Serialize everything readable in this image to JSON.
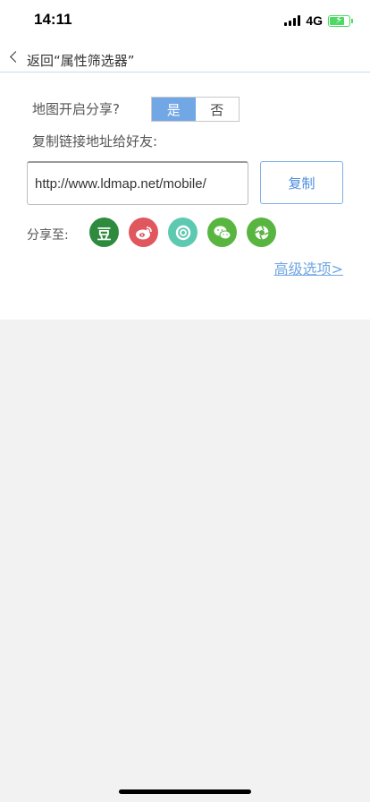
{
  "status_bar": {
    "time": "14:11",
    "network": "4G",
    "battery_color": "#4cd964"
  },
  "nav": {
    "back_icon": "chevron-left-icon",
    "title": "返回“属性筛选器”"
  },
  "share": {
    "question": "地图开启分享?",
    "toggle": {
      "yes_label": "是",
      "no_label": "否",
      "selected": "是",
      "active_color": "#72a7e6"
    },
    "copy_hint": "复制链接地址给好友:",
    "link_value": "http://www.ldmap.net/mobile/",
    "copy_button": "复制",
    "share_to_label": "分享至:",
    "platforms": [
      {
        "name": "douban-icon",
        "glyph": "豆",
        "color": "#2e8b3e"
      },
      {
        "name": "weibo-icon",
        "color": "#e0575e"
      },
      {
        "name": "circle-share-icon",
        "color": "#5dc9b1"
      },
      {
        "name": "wechat-icon",
        "color": "#58b540"
      },
      {
        "name": "moments-icon",
        "color": "#58b540"
      }
    ],
    "advanced_link": "高级选项>"
  }
}
